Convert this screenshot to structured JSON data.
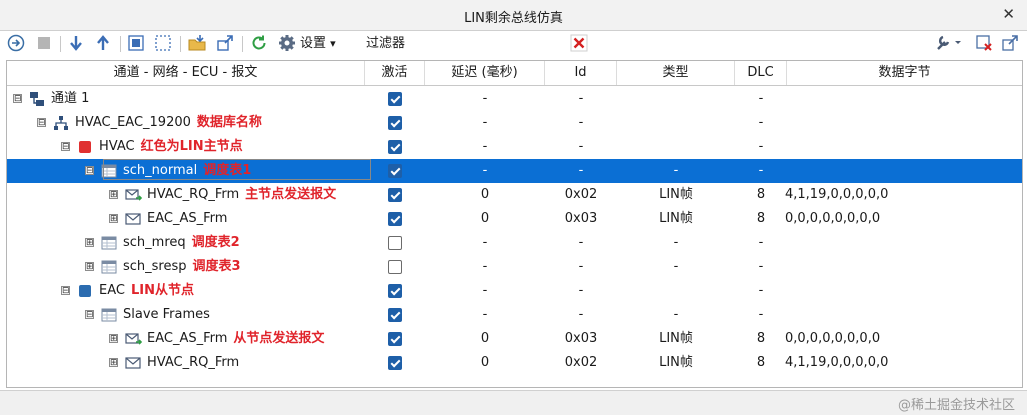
{
  "window": {
    "title": "LIN剩余总线仿真",
    "close_glyph": "✕"
  },
  "toolbar": {
    "settings_label": "设置",
    "settings_caret": "▾",
    "filter_label": "过滤器",
    "clear_filter_glyph": "✕",
    "icons": [
      "go-icon",
      "stop-icon",
      "move-down-icon",
      "move-up-icon",
      "select-all-icon",
      "deselect-icon",
      "import-icon",
      "export-icon",
      "refresh-icon",
      "settings-icon",
      "clear-filter-icon",
      "tools-icon",
      "close-window-icon",
      "detach-icon"
    ]
  },
  "columns": {
    "name": "通道 - 网络 - ECU - 报文",
    "active": "激活",
    "delay": "延迟 (毫秒)",
    "id": "Id",
    "type": "类型",
    "dlc": "DLC",
    "data": "数据字节"
  },
  "rows": [
    {
      "label": "通道 1",
      "annotation": "",
      "active": true,
      "delay": "-",
      "id": "-",
      "type": "",
      "dlc": "-",
      "data": "",
      "icon": "channel-icon",
      "expander": "⊟"
    },
    {
      "label": "HVAC_EAC_19200",
      "annotation": "数据库名称",
      "active": true,
      "delay": "-",
      "id": "-",
      "type": "",
      "dlc": "-",
      "data": "",
      "icon": "network-icon",
      "expander": "⊟"
    },
    {
      "label": "HVAC",
      "annotation": "红色为LIN主节点",
      "active": true,
      "delay": "-",
      "id": "-",
      "type": "",
      "dlc": "-",
      "data": "",
      "icon": "master-node-icon",
      "expander": "⊟"
    },
    {
      "label": "sch_normal",
      "annotation": "调度表1",
      "active": true,
      "delay": "-",
      "id": "-",
      "type": "-",
      "dlc": "-",
      "data": "",
      "icon": "schedule-table-icon",
      "expander": "⊟"
    },
    {
      "label": "HVAC_RQ_Frm",
      "annotation": "主节点发送报文",
      "active": true,
      "delay": "0",
      "id": "0x02",
      "type": "LIN帧",
      "dlc": "8",
      "data": "4,1,19,0,0,0,0,0",
      "icon": "send-frame-icon",
      "expander": "⊞"
    },
    {
      "label": "EAC_AS_Frm",
      "annotation": "",
      "active": true,
      "delay": "0",
      "id": "0x03",
      "type": "LIN帧",
      "dlc": "8",
      "data": "0,0,0,0,0,0,0,0",
      "icon": "frame-icon",
      "expander": "⊞"
    },
    {
      "label": "sch_mreq",
      "annotation": "调度表2",
      "active": false,
      "delay": "-",
      "id": "-",
      "type": "-",
      "dlc": "-",
      "data": "",
      "icon": "schedule-table-icon",
      "expander": "⊞"
    },
    {
      "label": "sch_sresp",
      "annotation": "调度表3",
      "active": false,
      "delay": "-",
      "id": "-",
      "type": "-",
      "dlc": "-",
      "data": "",
      "icon": "schedule-table-icon",
      "expander": "⊞"
    },
    {
      "label": "EAC",
      "annotation": "LIN从节点",
      "active": true,
      "delay": "-",
      "id": "-",
      "type": "",
      "dlc": "-",
      "data": "",
      "icon": "slave-node-icon",
      "expander": "⊟"
    },
    {
      "label": "Slave Frames",
      "annotation": "",
      "active": true,
      "delay": "-",
      "id": "-",
      "type": "-",
      "dlc": "-",
      "data": "",
      "icon": "schedule-table-icon",
      "expander": "⊟"
    },
    {
      "label": "EAC_AS_Frm",
      "annotation": "从节点发送报文",
      "active": true,
      "delay": "0",
      "id": "0x03",
      "type": "LIN帧",
      "dlc": "8",
      "data": "0,0,0,0,0,0,0,0",
      "icon": "send-frame-icon",
      "expander": "⊞"
    },
    {
      "label": "HVAC_RQ_Frm",
      "annotation": "",
      "active": true,
      "delay": "0",
      "id": "0x02",
      "type": "LIN帧",
      "dlc": "8",
      "data": "4,1,19,0,0,0,0,0",
      "icon": "frame-icon",
      "expander": "⊞"
    }
  ],
  "watermark": "@稀土掘金技术社区",
  "colors": {
    "selection": "#0b6fd4",
    "annotation": "#e0242b",
    "checkbox": "#1e5fa8",
    "master_node": "#e03030",
    "slave_node": "#2b6cb0"
  }
}
